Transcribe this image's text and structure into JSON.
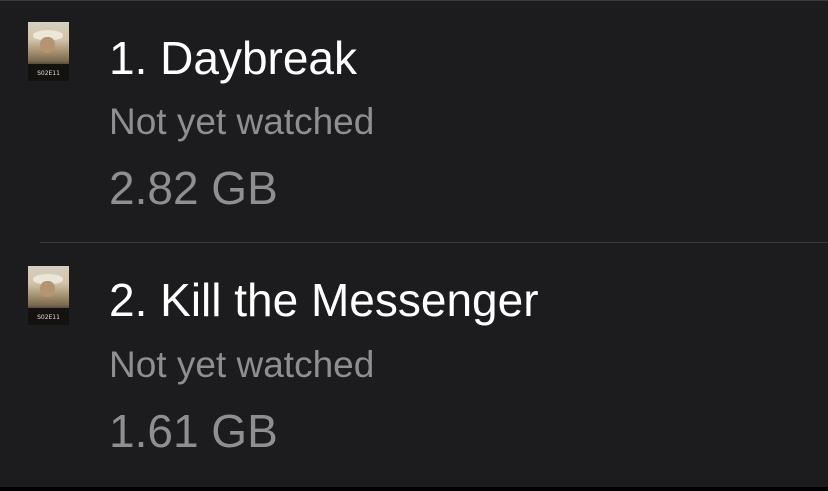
{
  "episodes": [
    {
      "title": "1. Daybreak",
      "status": "Not yet watched",
      "size": "2.82 GB",
      "thumbnail_label": "S02E11"
    },
    {
      "title": "2. Kill the Messenger",
      "status": "Not yet watched",
      "size": "1.61 GB",
      "thumbnail_label": "S02E11"
    }
  ],
  "colors": {
    "background": "#1c1c1e",
    "title_text": "#ffffff",
    "secondary_text": "#8e8e93",
    "separator": "#3a3a3c"
  }
}
